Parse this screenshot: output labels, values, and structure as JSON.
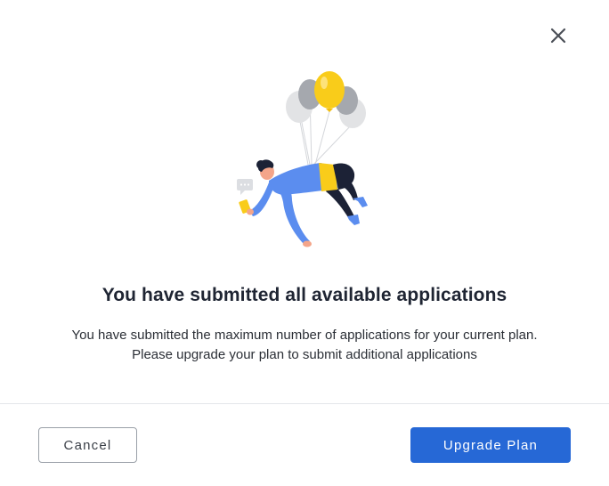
{
  "dialog": {
    "close_icon": "close-icon",
    "illustration_icon": "person-floating-with-balloons-illustration",
    "title": "You have submitted all available applications",
    "message_line1": "You have submitted the maximum number of applications for your current plan.",
    "message_line2": "Please upgrade your plan to submit additional applications",
    "cancel_label": "Cancel",
    "upgrade_label": "Upgrade Plan"
  },
  "colors": {
    "primary": "#2668d6",
    "title_text": "#1f2533",
    "balloon_yellow": "#f9cc1a",
    "balloon_gray": "#a5a8ae",
    "person_blue": "#5b8def",
    "person_navy": "#1c2236"
  }
}
